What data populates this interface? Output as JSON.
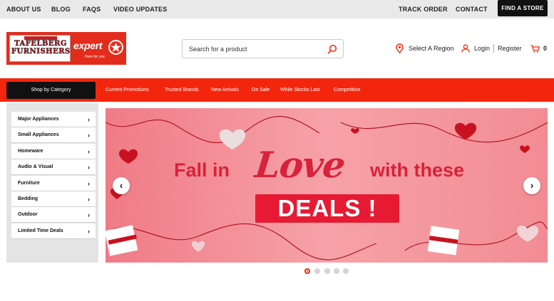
{
  "topbar": {
    "links": [
      "ABOUT US",
      "BLOG",
      "FAQS",
      "VIDEO UPDATES"
    ],
    "right_links": [
      "TRACK ORDER",
      "CONTACT"
    ],
    "find_store": "FIND A STORE"
  },
  "logo": {
    "line1": "TAFELBERG",
    "line2": "FURNISHERS",
    "expert": "expert",
    "expert_tagline": "Here for you."
  },
  "search": {
    "placeholder": "Search for a product"
  },
  "header": {
    "region": "Select A Region",
    "login": "Login",
    "register": "Register",
    "cart_count": "0"
  },
  "nav": {
    "shop_by_category": "Shop by Category",
    "links": [
      "Current Promotions",
      "Trusted Brands",
      "New Arrivals",
      "On Sale",
      "While Stocks Last",
      "Competition"
    ]
  },
  "sidebar": {
    "items": [
      "Major Appliances",
      "Small Appliances",
      "Homeware",
      "Audio & Visual",
      "Furniture",
      "Bedding",
      "Outdoor",
      "Limited Time Deals"
    ]
  },
  "banner": {
    "fall_in": "Fall in",
    "love": "Love",
    "with_these": "with these",
    "deals": "DEALS !",
    "dots": 5,
    "active_dot": 0
  },
  "colors": {
    "accent": "#f3260d",
    "dark": "#111111",
    "banner_pink": "#f6a2a8",
    "banner_red": "#d8223a"
  }
}
